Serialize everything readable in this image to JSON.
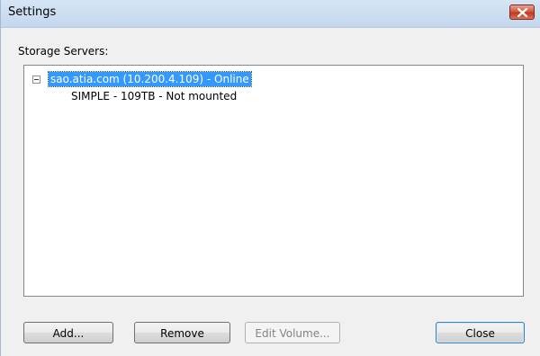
{
  "window": {
    "title": "Settings",
    "close_icon": "close-x-icon"
  },
  "storage": {
    "label": "Storage Servers:",
    "tree": {
      "root": {
        "label": "sao.atia.com (10.200.4.109) - Online",
        "expanded": true,
        "selected": true
      },
      "children": [
        {
          "label": "SIMPLE - 109TB - Not mounted"
        }
      ]
    }
  },
  "buttons": {
    "add": "Add...",
    "remove": "Remove",
    "edit_volume": "Edit Volume...",
    "close": "Close"
  },
  "colors": {
    "selection": "#3399ff",
    "close_button": "#c7432a"
  }
}
